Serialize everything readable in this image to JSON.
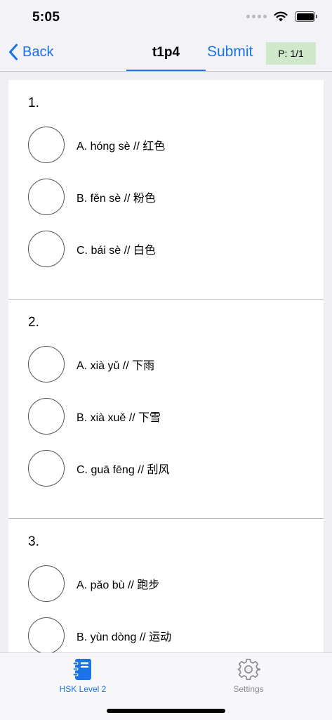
{
  "status": {
    "time": "5:05"
  },
  "nav": {
    "back_label": "Back",
    "title": "t1p4",
    "submit_label": "Submit",
    "page_indicator": "P: 1/1"
  },
  "questions": [
    {
      "number": "1.",
      "options": [
        "A. hóng sè // 红色",
        "B. fěn sè // 粉色",
        "C. bái sè // 白色"
      ]
    },
    {
      "number": "2.",
      "options": [
        "A. xià yǔ // 下雨",
        "B. xià xuě // 下雪",
        "C. guā fēng // 刮风"
      ]
    },
    {
      "number": "3.",
      "options": [
        "A. pǎo bù // 跑步",
        "B. yùn dòng // 运动"
      ]
    }
  ],
  "tabs": {
    "hsk_label": "HSK Level 2",
    "settings_label": "Settings"
  },
  "colors": {
    "accent": "#1a73e8",
    "badge_bg": "#cfe8c9",
    "inactive_tab": "#8e8e93"
  },
  "icons": {
    "back": "chevron-left-icon",
    "wifi": "wifi-icon",
    "battery": "battery-icon",
    "hsk_tab": "notebook-icon",
    "settings_tab": "gear-icon"
  }
}
